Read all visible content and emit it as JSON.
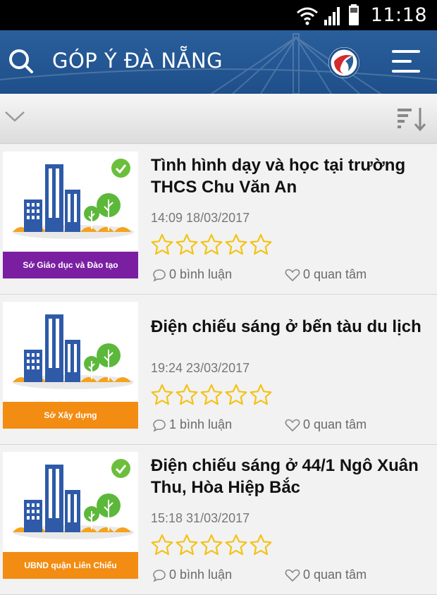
{
  "status_bar": {
    "time": "11:18"
  },
  "header": {
    "title": "GÓP Ý ĐÀ NẴNG"
  },
  "colors": {
    "purple": "#7a1fa2",
    "orange": "#f28c12",
    "header_blue": "#1e4f8a",
    "check_green": "#6cbf3c",
    "star_yellow": "#f3c316"
  },
  "feedbacks": [
    {
      "title": "Tình hình dạy và học tại trường THCS Chu Văn An",
      "timestamp": "14:09 18/03/2017",
      "department": "Sở Giáo dục và Đào tạo",
      "department_color": "purple",
      "resolved": true,
      "comments": "0 bình luận",
      "interest": "0 quan tâm",
      "rating": 0
    },
    {
      "title": "Điện chiếu sáng ở bến tàu du lịch",
      "timestamp": "19:24 23/03/2017",
      "department": "Sở Xây dựng",
      "department_color": "orange",
      "resolved": false,
      "comments": "1 bình luận",
      "interest": "0 quan tâm",
      "rating": 0
    },
    {
      "title": "Điện chiếu sáng ở 44/1 Ngô Xuân Thu, Hòa Hiệp Bắc",
      "timestamp": "15:18 31/03/2017",
      "department": "UBND quận Liên Chiểu",
      "department_color": "orange",
      "resolved": true,
      "comments": "0 bình luận",
      "interest": "0 quan tâm",
      "rating": 0
    }
  ]
}
